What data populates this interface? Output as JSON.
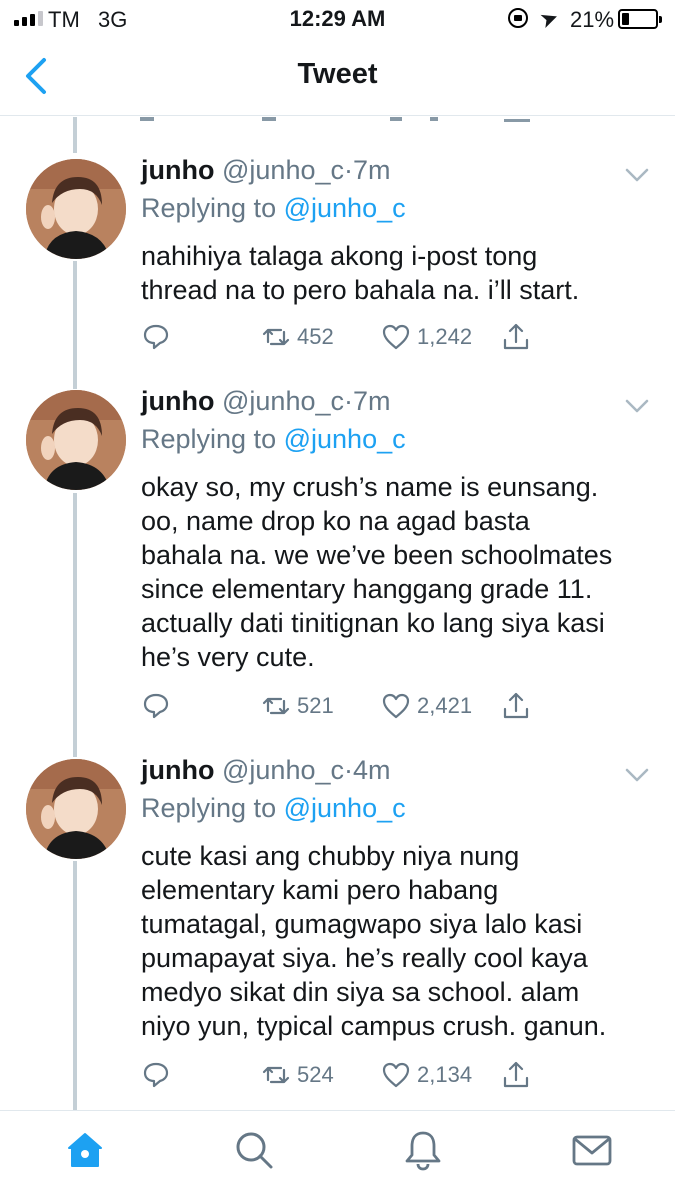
{
  "status_bar": {
    "carrier": "TM",
    "network": "3G",
    "time": "12:29 AM",
    "battery_percent": "21%",
    "battery_level": 0.21,
    "icons": [
      "signal-icon",
      "orientation-lock-icon",
      "location-icon",
      "battery-icon"
    ]
  },
  "nav": {
    "title": "Tweet",
    "back_icon": "chevron-left-icon"
  },
  "colors": {
    "accent": "#1da1f2",
    "secondary_text": "#657786",
    "thread_line": "#c4cfd6"
  },
  "tweets": [
    {
      "name": "junho",
      "handle": "@junho_c",
      "dot": "·",
      "time": "7m",
      "reply_prefix": "Replying to",
      "reply_to": "@junho_c",
      "lines": [
        "nahihiya talaga akong i-post tong",
        "thread na to pero bahala na. i’ll start."
      ],
      "retweets": "452",
      "likes": "1,242"
    },
    {
      "name": "junho",
      "handle": "@junho_c",
      "dot": "·",
      "time": "7m",
      "reply_prefix": "Replying to",
      "reply_to": "@junho_c",
      "lines": [
        "okay so, my crush’s name is eunsang.",
        "oo, name drop ko na agad basta",
        "bahala na. we we’ve been schoolmates",
        "since elementary hanggang grade 11.",
        "actually dati tinitignan ko lang siya kasi",
        "he’s very cute."
      ],
      "retweets": "521",
      "likes": "2,421"
    },
    {
      "name": "junho",
      "handle": "@junho_c",
      "dot": "·",
      "time": "4m",
      "reply_prefix": "Replying to",
      "reply_to": "@junho_c",
      "lines": [
        "cute kasi ang chubby niya nung",
        "elementary kami pero habang",
        "tumatagal, gumagwapo siya lalo kasi",
        "pumapayat siya. he’s really cool kaya",
        "medyo sikat din siya sa school. alam",
        "niyo yun, typical campus crush. ganun."
      ],
      "retweets": "524",
      "likes": "2,134"
    }
  ],
  "tabbar": {
    "items": [
      "home-icon",
      "search-icon",
      "notifications-icon",
      "messages-icon"
    ],
    "active": "home-icon"
  }
}
